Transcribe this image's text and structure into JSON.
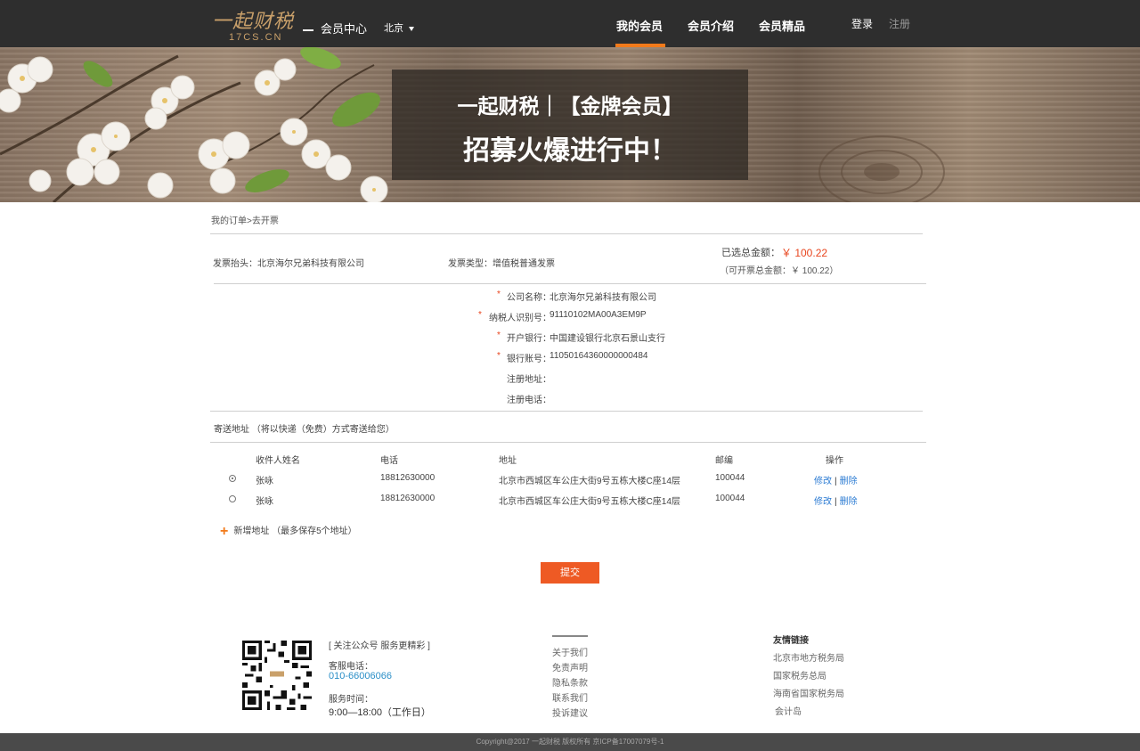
{
  "header": {
    "logo_text": "一起财税",
    "logo_sub": "17CS.CN",
    "member_center": "会员中心",
    "city": "北京",
    "nav": [
      {
        "label": "我的会员",
        "active": true
      },
      {
        "label": "会员介绍",
        "active": false
      },
      {
        "label": "会员精品",
        "active": false
      }
    ],
    "login": "登录",
    "register": "注册",
    "accent": "#f27a1a"
  },
  "banner": {
    "line1": "一起财税｜【金牌会员】",
    "line2": "招募火爆进行中！"
  },
  "breadcrumb": "我的订单>去开票",
  "invoice": {
    "title_label": "发票抬头：",
    "title_value": "北京海尔兄弟科技有限公司",
    "type_label": "发票类型：",
    "type_value": "增值税普通发票",
    "total_label": "已选总金额：",
    "total_value": "￥ 100.22",
    "available": "（可开票总金额：￥ 100.22）"
  },
  "company_form": [
    {
      "required": true,
      "label": "公司名称：",
      "value": "北京海尔兄弟科技有限公司"
    },
    {
      "required": true,
      "label": "纳税人识别号：",
      "value": "91110102MA00A3EM9P"
    },
    {
      "required": true,
      "label": "开户银行：",
      "value": "中国建设银行北京石景山支行"
    },
    {
      "required": true,
      "label": "银行账号：",
      "value": "11050164360000000484"
    },
    {
      "required": false,
      "label": "注册地址：",
      "value": ""
    },
    {
      "required": false,
      "label": "注册电话：",
      "value": ""
    }
  ],
  "shipping": {
    "title": "寄送地址 （将以快递（免费）方式寄送给您）",
    "columns": [
      "收件人姓名",
      "电话",
      "地址",
      "邮编",
      "操作"
    ],
    "rows": [
      {
        "selected": true,
        "name": "张咏",
        "phone": "18812630000",
        "address": "北京市西城区车公庄大街9号五栋大楼C座14层",
        "zip": "100044",
        "edit": "修改",
        "delete": "删除"
      },
      {
        "selected": false,
        "name": "张咏",
        "phone": "18812630000",
        "address": "北京市西城区车公庄大街9号五栋大楼C座14层",
        "zip": "100044",
        "edit": "修改",
        "delete": "删除"
      }
    ],
    "add_label": "新增地址 （最多保存5个地址）"
  },
  "submit_label": "提交",
  "footer": {
    "wechat": "[ 关注公众号 服务更精彩 ]",
    "service_tel_label": "客服电话：",
    "service_tel": "010-66006066",
    "service_time_label": "服务时间：",
    "service_time": "9:00—18:00（工作日）",
    "links": [
      "关于我们",
      "免责声明",
      "隐私条款",
      "联系我们",
      "投诉建议"
    ],
    "friend_title": "友情链接",
    "friend_links": [
      "北京市地方税务局",
      "国家税务总局",
      "海南省国家税务局",
      "会计岛"
    ],
    "copyright": "Copyright@2017 一起财税 版权所有 京ICP备17007079号-1"
  }
}
